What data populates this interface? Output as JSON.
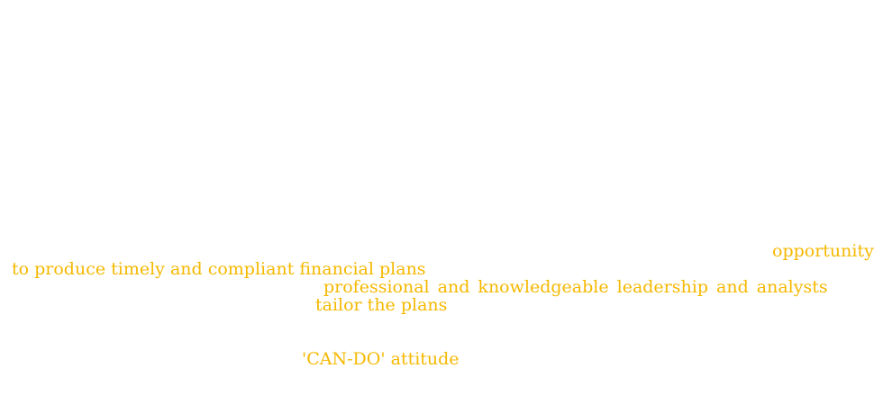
{
  "highlights": [
    "opportunity",
    "to produce timely and compliant financial plans",
    "professional and knowledgeable leadership and analysts",
    "tailor the plans",
    "'CAN-DO' attitude"
  ],
  "colors": {
    "background": "#ffffff",
    "highlight_text": "#f5b800"
  }
}
